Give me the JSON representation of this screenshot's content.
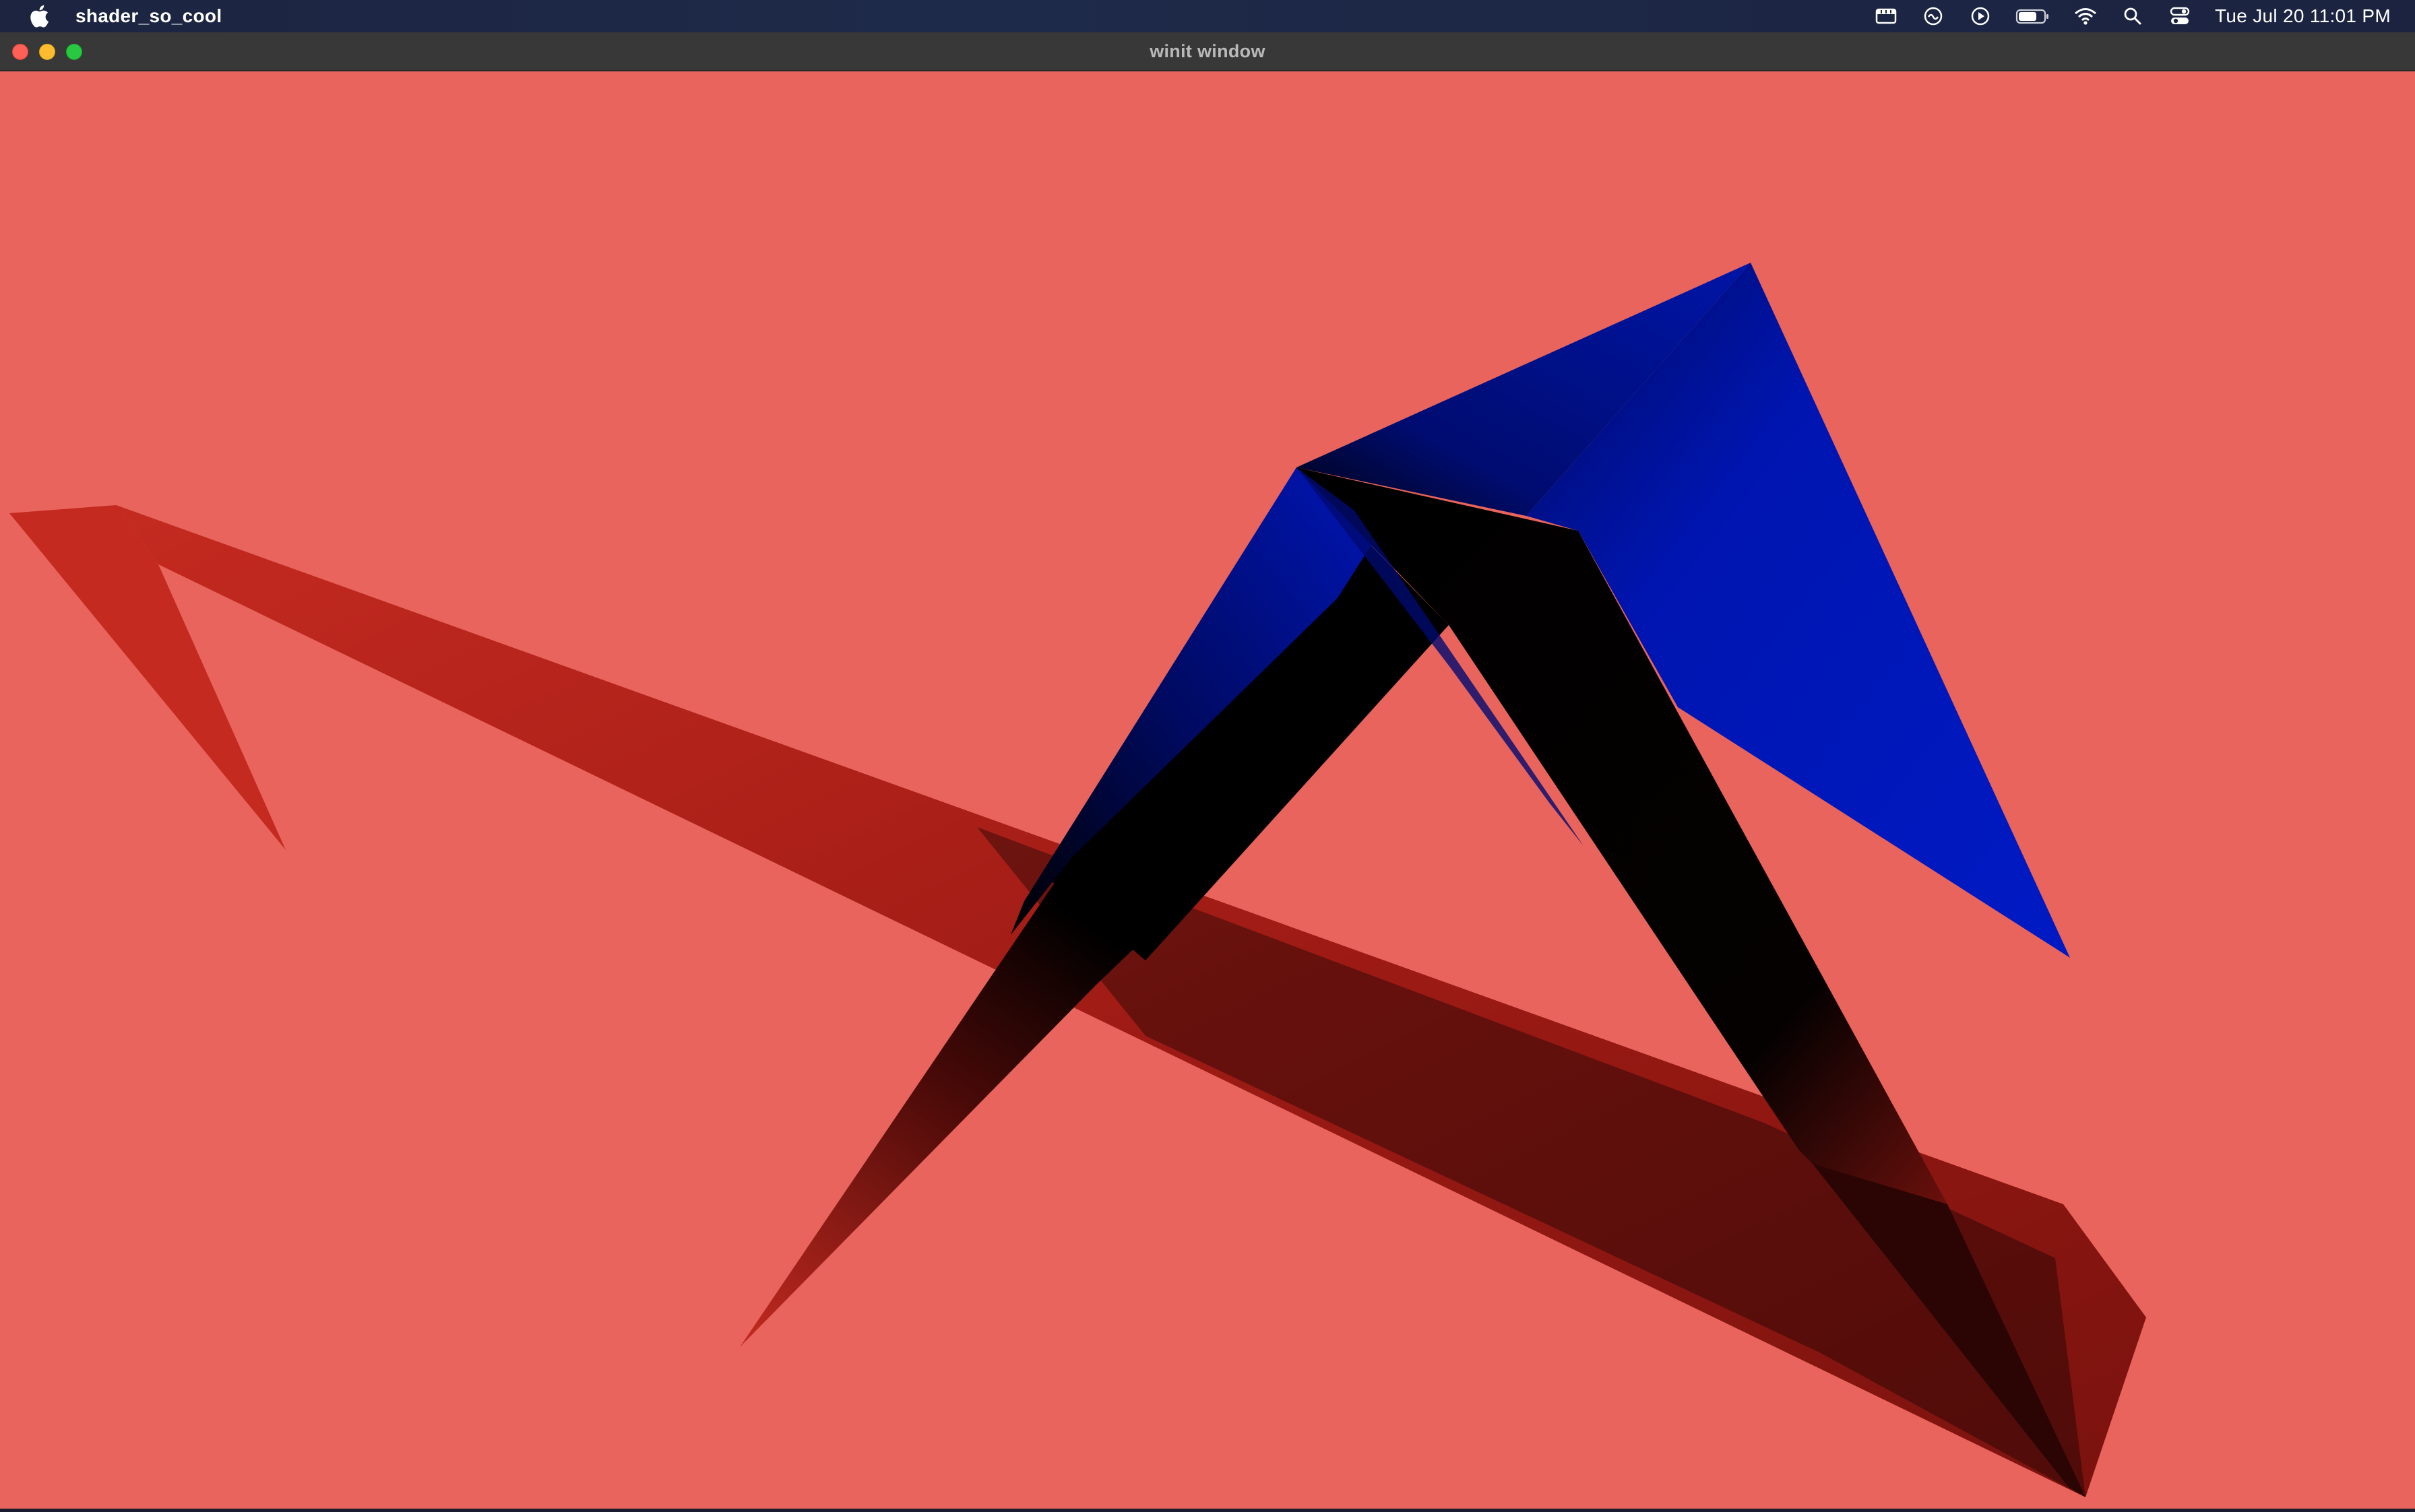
{
  "menubar": {
    "app_name": "shader_so_cool",
    "clock": "Tue Jul 20  11:01 PM",
    "status_icons": [
      "screen-recording-icon",
      "sync-icon",
      "play-icon",
      "battery-icon",
      "wifi-icon",
      "spotlight-search-icon",
      "control-center-icon"
    ]
  },
  "window": {
    "title": "winit window",
    "background_color": "#e8645c"
  },
  "scene": {
    "description_colors": {
      "red_shape": "#c42a20",
      "blue_shape": "#0015b8",
      "shadow": "#000000"
    }
  }
}
